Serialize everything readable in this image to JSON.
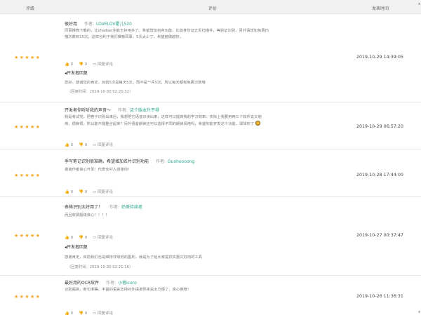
{
  "header": {
    "rating": "评级",
    "review": "评价",
    "time": "发表时间"
  },
  "actions": {
    "like": "0",
    "dislike": "0",
    "reply": "回复评论"
  },
  "rows": [
    {
      "stars": "★★★★★",
      "title": "很好用",
      "author_label": "作者:",
      "author": "LOVELOV霍儿520",
      "body": [
        "同事推荐下载的，比zhadiao全能王好用多了。希望增加自身功能，比如身份证正反扫描件，等验证识别，另外请增加免费扫",
        "描次数到15次，这样也利于我们推荐同事，5次太少了。希望越做越好。"
      ],
      "reply_label": "开发者回复",
      "reply_body": "您好，感谢您的肯定，目前5次是每天5次，而不是一共5次，所以每天都有免费次数哦",
      "reply_time": "（回复时间：2019-10-30 02:20:32）",
      "date": "2019-10-29 14:39:05"
    },
    {
      "stars": "★★★★★",
      "title": "开发者你听听我的声音～",
      "author_label": "作者:",
      "author": "这个版本升不得",
      "body": [
        "我是考试党，把卷子识别出来后，我想把它语音识读出来，这样可以提高我的学习效率，实际上我要用两三个软件去又使",
        "用，很麻烦，所以能不能整合起来？另外语音朗读还可以选择不同的朗读风格吗，希望你能开发这个功能，球球你了"
      ],
      "date": "2019-10-29 06:57:20"
    },
    {
      "stars": "★★★★★",
      "title": "手写笔记识别很准确，希望增加名片识别功能",
      "author_label": "作者:",
      "author": "Guohoooong",
      "body": [
        "谢谢作者良心开发！代表全村人感谢你!"
      ],
      "date": "2019-10-28 17:44:00"
    },
    {
      "stars": "★★★★★",
      "title": "表格识别太好用了！",
      "author_label": "作者:",
      "author": "奶茶待续者",
      "body": [
        "而且收费超级良心！！！！"
      ],
      "reply_label": "开发者回复",
      "reply_body": "感谢肯定，目前我们也是维持非常低的盈利，就是为了给大家提供实惠又好用的工具",
      "reply_time": "（回复时间：2019-10-30 02:21:16）",
      "date": "2019-10-27 00:37:47"
    },
    {
      "stars": "★★★★★",
      "title": "最好用的OCR软件",
      "author_label": "作者:",
      "author": "小蓉icero",
      "body": [
        "识别超高，断句准确，丰富的语言支持对外语老师来说太方便了，良心推荐！"
      ],
      "date": "2019-10-26 11:36:31"
    }
  ]
}
